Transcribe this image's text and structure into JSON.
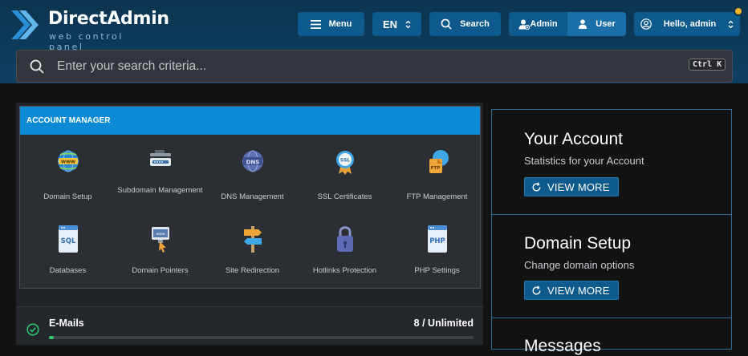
{
  "brand": {
    "name": "DirectAdmin",
    "tagline": "web control panel",
    "logo_icon": "directadmin-logo-icon"
  },
  "header": {
    "menu_label": "Menu",
    "language": "EN",
    "search_label": "Search",
    "admin_label": "Admin",
    "user_label": "User",
    "greeting": "Hello, admin",
    "notification_color": "#f0b323"
  },
  "search": {
    "placeholder": "Enter your search criteria...",
    "shortcut": "Ctrl K"
  },
  "account_manager": {
    "title": "ACCOUNT MANAGER",
    "items": [
      {
        "label": "Domain Setup",
        "icon": "globe-www-icon"
      },
      {
        "label": "Subdomain Management",
        "icon": "subdomain-server-icon"
      },
      {
        "label": "DNS Management",
        "icon": "dns-icon"
      },
      {
        "label": "SSL Certificates",
        "icon": "ssl-badge-icon"
      },
      {
        "label": "FTP Management",
        "icon": "ftp-folder-icon"
      },
      {
        "label": "Databases",
        "icon": "sql-database-icon"
      },
      {
        "label": "Domain Pointers",
        "icon": "domain-pointer-icon"
      },
      {
        "label": "Site Redirection",
        "icon": "signpost-icon"
      },
      {
        "label": "Hotlinks Protection",
        "icon": "padlock-icon"
      },
      {
        "label": "PHP Settings",
        "icon": "php-file-icon"
      }
    ]
  },
  "emails": {
    "title": "E-Mails",
    "count": "8 / Unlimited",
    "status_icon": "check-circle-icon",
    "usage_fraction": 0.01
  },
  "right_panel": {
    "sections": [
      {
        "title": "Your Account",
        "subtitle": "Statistics for your Account",
        "button": "VIEW MORE"
      },
      {
        "title": "Domain Setup",
        "subtitle": "Change domain options",
        "button": "VIEW MORE"
      },
      {
        "title": "Messages"
      }
    ]
  },
  "colors": {
    "accent": "#0d8ad6",
    "header_bg": "#0c3450",
    "button_bg": "#0f5a8c",
    "success": "#2ecc71"
  }
}
